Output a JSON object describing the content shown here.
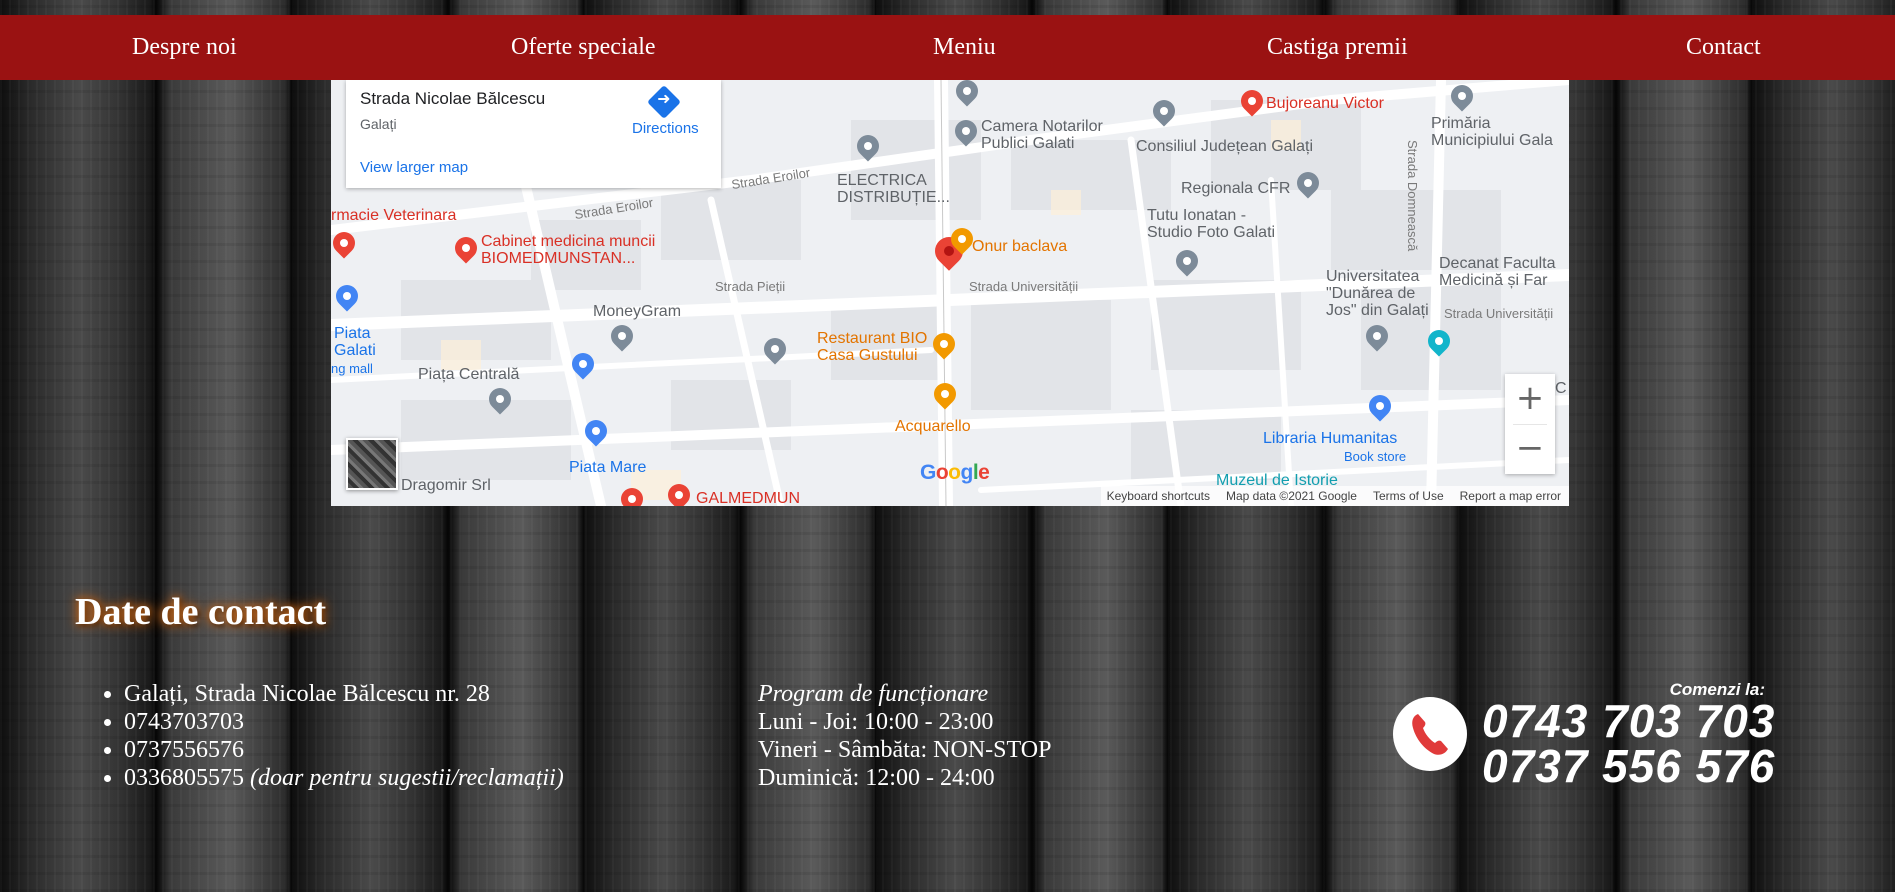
{
  "nav": {
    "items": [
      {
        "label": "Despre noi"
      },
      {
        "label": "Oferte speciale"
      },
      {
        "label": "Meniu"
      },
      {
        "label": "Castiga premii"
      },
      {
        "label": "Contact"
      }
    ],
    "background": "#9a1212"
  },
  "map": {
    "card": {
      "title": "Strada Nicolae Bălcescu",
      "subtitle": "Galați",
      "view_larger": "View larger map",
      "directions": "Directions"
    },
    "labels": {
      "camera_notarilor": "Camera Notarilor\nPublici Galati",
      "bujoreanu": "Bujoreanu Victor",
      "primaria": "Primăria\nMunicipiului Gala",
      "consiliul": "Consiliul Județean Galați",
      "electrica": "ELECTRICA\nDISTRIBUȚIE...",
      "regionala": "Regionala CFR",
      "farmacie": "rmacie Veterinara",
      "cabinet": "Cabinet medicina muncii\nBIOMEDMUNSTAN...",
      "onur": "Onur baclava",
      "tutu": "Tutu Ionatan -\nStudio Foto Galati",
      "decanat": "Decanat Faculta\nMedicină și Far",
      "universitatea": "Universitatea\n\"Dunărea de\nJos\" din Galați",
      "moneygram": "MoneyGram",
      "piata_galati": "Piata\nGalati",
      "mall": "ng mall",
      "restaurant_bio": "Restaurant BIO\nCasa Gustului",
      "piata_centrala": "Piața Centrală",
      "acquarello": "Acquarello",
      "libraria": "Libraria Humanitas",
      "book_store": "Book store",
      "piata_mare": "Piata Mare",
      "dragomir": "Dragomir Srl",
      "galmedmun": "GALMEDMUN",
      "muzeul": "Muzeul de Istorie",
      "strada_eroilor": "Strada Eroilor",
      "strada_pietii": "Strada Pieții",
      "strada_universitatii": "Strada Universității",
      "strada_universitatii_2": "Strada Universității",
      "strada_domneasca": "Strada Domnească",
      "c": "C"
    },
    "google": "Google",
    "footer": {
      "keyboard": "Keyboard shortcuts",
      "map_data": "Map data ©2021 Google",
      "terms": "Terms of Use",
      "report": "Report a map error"
    },
    "zoom_in": "+",
    "zoom_out": "−"
  },
  "contact": {
    "title": "Date de contact",
    "address": "Galați, Strada Nicolae Bălcescu nr. 28",
    "phone1": "0743703703",
    "phone2": "0737556576",
    "phone3": "0336805575",
    "phone3_note": "(doar pentru sugestii/reclamații)",
    "hours_title": "Program de funcționare",
    "hours": [
      "Luni - Joi: 10:00 - 23:00",
      "Vineri - Sâmbăta: NON-STOP",
      "Duminică: 12:00 - 24:00"
    ]
  },
  "order": {
    "header": "Comenzi la:",
    "number1": "0743 703 703",
    "number2": "0737 556 576"
  }
}
